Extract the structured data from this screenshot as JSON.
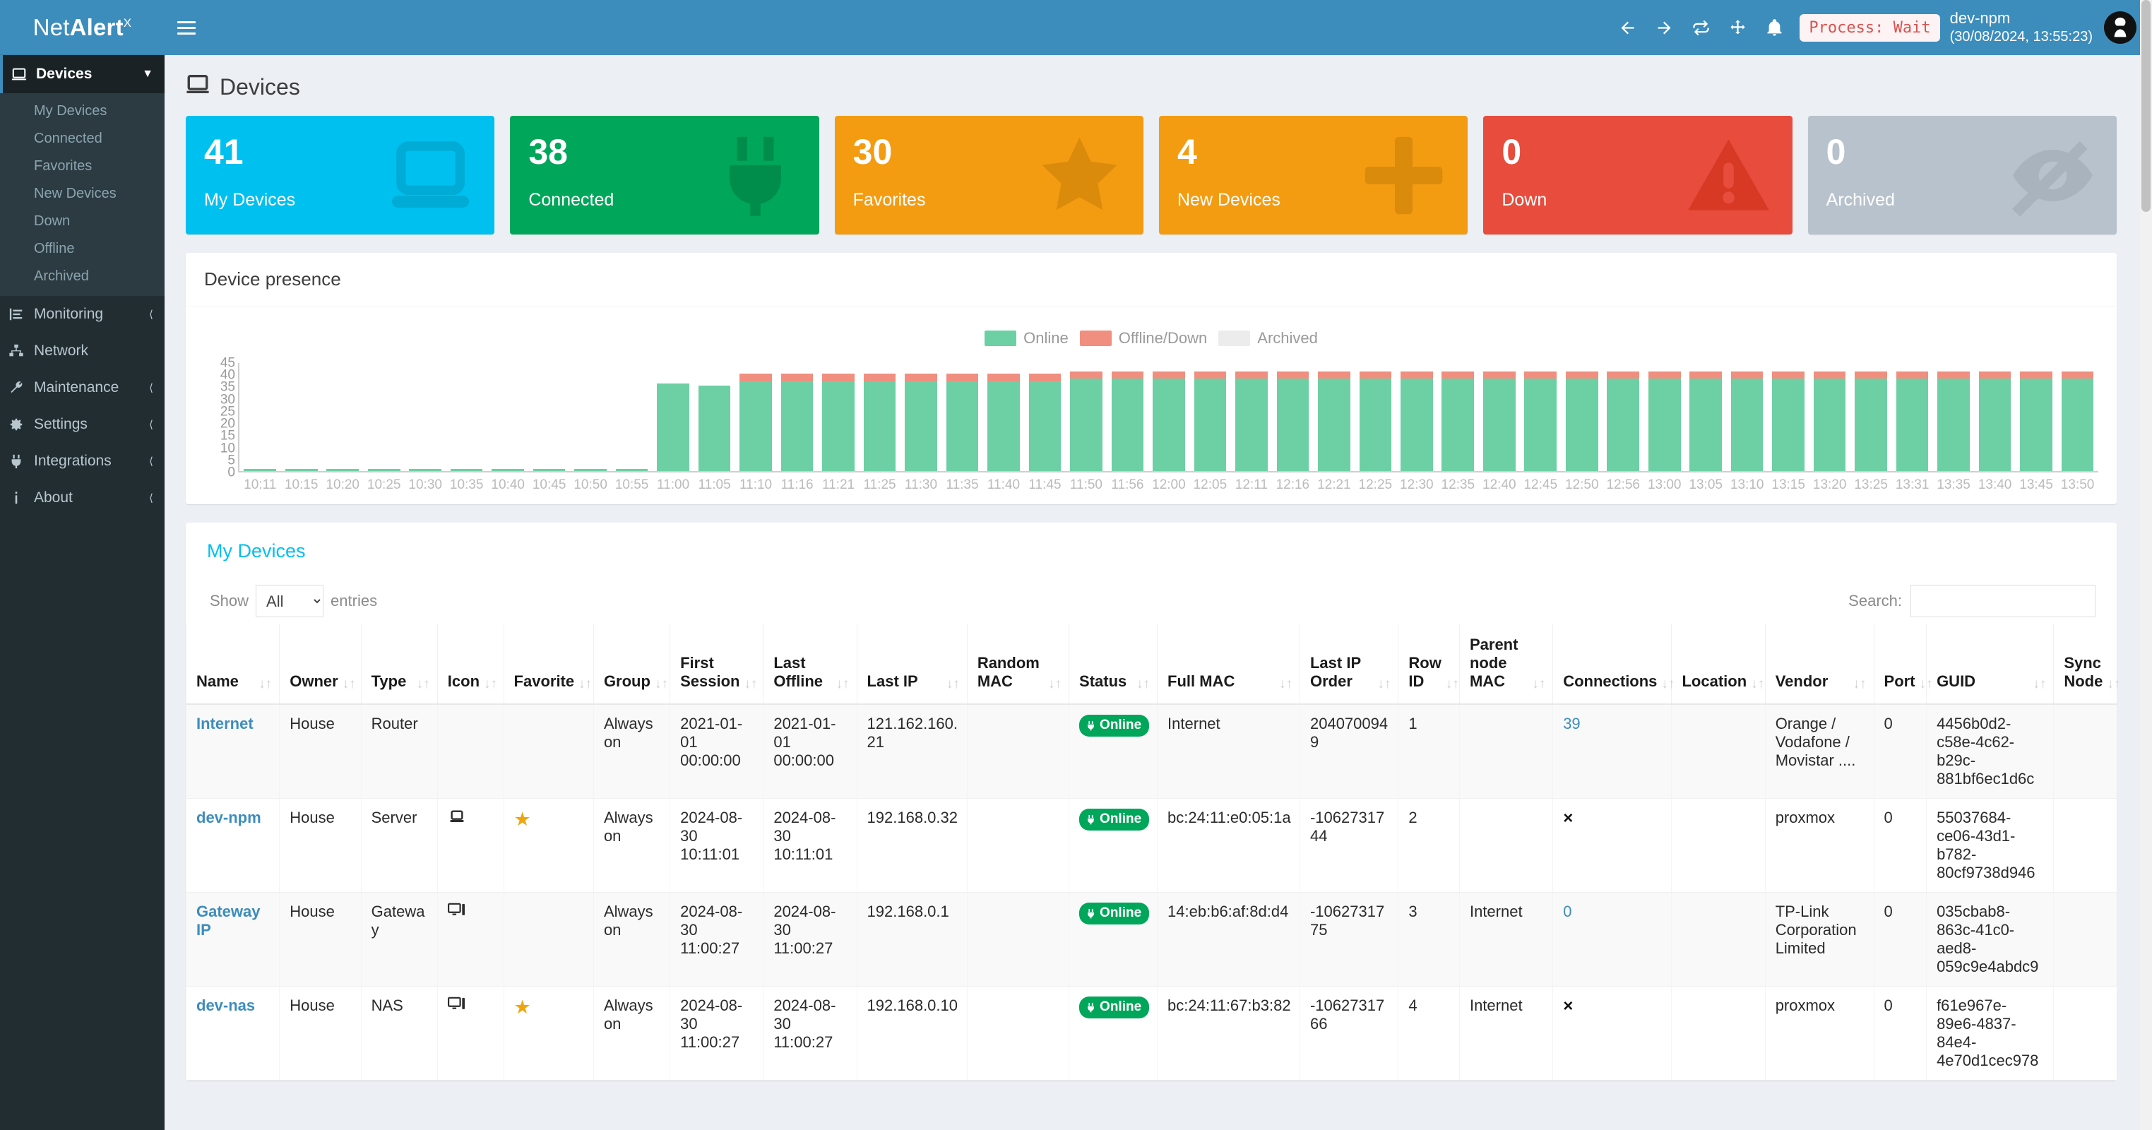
{
  "app": {
    "logo_prefix": "Net",
    "logo_bold": "Alert",
    "logo_sup": "X"
  },
  "header": {
    "icons": [
      "back-arrow-icon",
      "forward-arrow-icon",
      "refresh-icon",
      "move-icon",
      "bell-icon"
    ],
    "process_badge": "Process: Wait",
    "hostname": "dev-npm",
    "timestamp": "(30/08/2024, 13:55:23)",
    "avatar": "user-avatar"
  },
  "sidebar": {
    "active": {
      "label": "Devices",
      "icon": "laptop-icon",
      "chevron": "chevron-down-icon"
    },
    "sub_items": [
      {
        "label": "My Devices"
      },
      {
        "label": "Connected"
      },
      {
        "label": "Favorites"
      },
      {
        "label": "New Devices"
      },
      {
        "label": "Down"
      },
      {
        "label": "Offline"
      },
      {
        "label": "Archived"
      }
    ],
    "items": [
      {
        "label": "Monitoring",
        "icon": "chart-bars-icon",
        "chevron": "chevron-left-icon"
      },
      {
        "label": "Network",
        "icon": "sitemap-icon",
        "chevron": ""
      },
      {
        "label": "Maintenance",
        "icon": "wrench-icon",
        "chevron": "chevron-left-icon"
      },
      {
        "label": "Settings",
        "icon": "gear-icon",
        "chevron": "chevron-left-icon"
      },
      {
        "label": "Integrations",
        "icon": "plug-icon",
        "chevron": "chevron-left-icon"
      },
      {
        "label": "About",
        "icon": "info-icon",
        "chevron": "chevron-left-icon"
      }
    ]
  },
  "page": {
    "title": "Devices",
    "title_icon": "laptop-icon"
  },
  "cards": [
    {
      "value": "41",
      "label": "My Devices",
      "color": "#00c0ef",
      "icon_color": "#00acd6",
      "icon": "laptop-icon"
    },
    {
      "value": "38",
      "label": "Connected",
      "color": "#00a65a",
      "icon_color": "#008d4c",
      "icon": "plug-icon"
    },
    {
      "value": "30",
      "label": "Favorites",
      "color": "#f39c12",
      "icon_color": "#db8b0b",
      "icon": "star-icon"
    },
    {
      "value": "4",
      "label": "New Devices",
      "color": "#f39c12",
      "icon_color": "#db8b0b",
      "icon": "plus-icon"
    },
    {
      "value": "0",
      "label": "Down",
      "color": "#e74c3c",
      "icon_color": "#d73925",
      "icon": "warning-triangle-icon"
    },
    {
      "value": "0",
      "label": "Archived",
      "color": "#b8c2cc",
      "icon_color": "#a8b3bd",
      "icon": "eye-slash-icon"
    }
  ],
  "chart_panel": {
    "title": "Device presence"
  },
  "chart_data": {
    "type": "bar",
    "title": "Device presence",
    "xlabel": "",
    "ylabel": "",
    "ylim": [
      0,
      45
    ],
    "yticks": [
      0,
      5,
      10,
      15,
      20,
      25,
      30,
      35,
      40,
      45
    ],
    "grid": false,
    "stacked": true,
    "legend_position": "top-center",
    "legend": [
      {
        "name": "Online",
        "color": "#6cd0a4"
      },
      {
        "name": "Offline/Down",
        "color": "#f08f80"
      },
      {
        "name": "Archived",
        "color": "#ececec"
      }
    ],
    "categories": [
      "10:11",
      "10:15",
      "10:20",
      "10:25",
      "10:30",
      "10:35",
      "10:40",
      "10:45",
      "10:50",
      "10:55",
      "11:00",
      "11:05",
      "11:10",
      "11:16",
      "11:21",
      "11:25",
      "11:30",
      "11:35",
      "11:40",
      "11:45",
      "11:50",
      "11:56",
      "12:00",
      "12:05",
      "12:11",
      "12:16",
      "12:21",
      "12:25",
      "12:30",
      "12:35",
      "12:40",
      "12:45",
      "12:50",
      "12:56",
      "13:00",
      "13:05",
      "13:10",
      "13:15",
      "13:20",
      "13:25",
      "13:31",
      "13:35",
      "13:40",
      "13:45",
      "13:50"
    ],
    "series": [
      {
        "name": "Online",
        "color": "#6cd0a4",
        "values": [
          1,
          1,
          1,
          1,
          1,
          1,
          1,
          1,
          1,
          1,
          36,
          35,
          37,
          37,
          37,
          37,
          37,
          37,
          37,
          37,
          38,
          38,
          38,
          38,
          38,
          38,
          38,
          38,
          38,
          38,
          38,
          38,
          38,
          38,
          38,
          38,
          38,
          38,
          38,
          38,
          38,
          38,
          38,
          38,
          38
        ]
      },
      {
        "name": "Offline/Down",
        "color": "#f08f80",
        "values": [
          0,
          0,
          0,
          0,
          0,
          0,
          0,
          0,
          0,
          0,
          0,
          0,
          3,
          3,
          3,
          3,
          3,
          3,
          3,
          3,
          3,
          3,
          3,
          3,
          3,
          3,
          3,
          3,
          3,
          3,
          3,
          3,
          3,
          3,
          3,
          3,
          3,
          3,
          3,
          3,
          3,
          3,
          3,
          3,
          3
        ]
      },
      {
        "name": "Archived",
        "color": "#ececec",
        "values": [
          0,
          0,
          0,
          0,
          0,
          0,
          0,
          0,
          0,
          0,
          0,
          0,
          0,
          0,
          0,
          0,
          0,
          0,
          0,
          0,
          0,
          0,
          0,
          0,
          0,
          0,
          0,
          0,
          0,
          0,
          0,
          0,
          0,
          0,
          0,
          0,
          0,
          0,
          0,
          0,
          0,
          0,
          0,
          0,
          0
        ]
      }
    ]
  },
  "table": {
    "title": "My Devices",
    "show_label": "Show",
    "entries_label": "entries",
    "page_size": "All",
    "page_size_options": [
      "All",
      "10",
      "25",
      "50",
      "100"
    ],
    "search_label": "Search:",
    "search_value": "",
    "search_placeholder": "",
    "columns": [
      {
        "label": "First Session",
        "key": "first_session",
        "sortable": true
      },
      {
        "label": "Name",
        "key": "name",
        "sortable": true
      },
      {
        "label": "Owner",
        "key": "owner",
        "sortable": true
      },
      {
        "label": "Type",
        "key": "type",
        "sortable": true
      },
      {
        "label": "Icon",
        "key": "icon",
        "sortable": true
      },
      {
        "label": "Favorite",
        "key": "favorite",
        "sortable": true
      },
      {
        "label": "Group",
        "key": "group",
        "sortable": true
      },
      {
        "label": "Last Offline",
        "key": "last_offline",
        "sortable": true
      },
      {
        "label": "Last IP",
        "key": "last_ip",
        "sortable": true
      },
      {
        "label": "Random MAC",
        "key": "random_mac",
        "sortable": true
      },
      {
        "label": "Status",
        "key": "status",
        "sortable": true
      },
      {
        "label": "Full MAC",
        "key": "full_mac",
        "sortable": true
      },
      {
        "label": "Last IP Order",
        "key": "last_ip_order",
        "sortable": true
      },
      {
        "label": "Row ID",
        "key": "row_id",
        "sortable": true
      },
      {
        "label": "Parent node MAC",
        "key": "parent_node_mac",
        "sortable": true
      },
      {
        "label": "Connections",
        "key": "connections",
        "sortable": true
      },
      {
        "label": "Location",
        "key": "location",
        "sortable": true
      },
      {
        "label": "Vendor",
        "key": "vendor",
        "sortable": true
      },
      {
        "label": "Port",
        "key": "port",
        "sortable": true
      },
      {
        "label": "GUID",
        "key": "guid",
        "sortable": true
      },
      {
        "label": "Sync Node",
        "key": "sync_node",
        "sortable": true
      }
    ],
    "header_order": [
      "Name",
      "Owner",
      "Type",
      "Icon",
      "Favorite",
      "Group",
      "First Session",
      "Last Offline",
      "Last IP",
      "Random MAC",
      "Status",
      "Full MAC",
      "Last IP Order",
      "Row ID",
      "Parent node MAC",
      "Connections",
      "Location",
      "Vendor",
      "Port",
      "GUID",
      "Sync Node"
    ],
    "rows": [
      {
        "name": "Internet",
        "owner": "House",
        "type": "Router",
        "icon": "",
        "favorite": "",
        "group": "Always on",
        "first_session": "2021-01-01 00:00:00",
        "last_offline": "2021-01-01 00:00:00",
        "last_ip": "121.162.160.21",
        "random_mac": "",
        "status": "Online",
        "full_mac": "Internet",
        "last_ip_order": "2040700949",
        "row_id": "1",
        "parent_node_mac": "",
        "connections": "39",
        "connections_is_link": true,
        "location": "",
        "vendor": "Orange / Vodafone / Movistar ....",
        "port": "0",
        "guid": "4456b0d2-c58e-4c62-b29c-881bf6ec1d6c",
        "sync_node": ""
      },
      {
        "name": "dev-npm",
        "owner": "House",
        "type": "Server",
        "icon": "laptop-icon",
        "favorite": "star-icon",
        "group": "Always on",
        "first_session": "2024-08-30 10:11:01",
        "last_offline": "2024-08-30 10:11:01",
        "last_ip": "192.168.0.32",
        "random_mac": "",
        "status": "Online",
        "full_mac": "bc:24:11:e0:05:1a",
        "last_ip_order": "-1062731744",
        "row_id": "2",
        "parent_node_mac": "",
        "connections": "×",
        "connections_is_link": false,
        "location": "",
        "vendor": "proxmox",
        "port": "0",
        "guid": "55037684-ce06-43d1-b782-80cf9738d946",
        "sync_node": ""
      },
      {
        "name": "Gateway IP",
        "owner": "House",
        "type": "Gateway",
        "icon": "desktop-icon",
        "favorite": "",
        "group": "Always on",
        "first_session": "2024-08-30 11:00:27",
        "last_offline": "2024-08-30 11:00:27",
        "last_ip": "192.168.0.1",
        "random_mac": "",
        "status": "Online",
        "full_mac": "14:eb:b6:af:8d:d4",
        "last_ip_order": "-1062731775",
        "row_id": "3",
        "parent_node_mac": "Internet",
        "connections": "0",
        "connections_is_link": true,
        "location": "",
        "vendor": "TP-Link Corporation Limited",
        "port": "0",
        "guid": "035cbab8-863c-41c0-aed8-059c9e4abdc9",
        "sync_node": ""
      },
      {
        "name": "dev-nas",
        "owner": "House",
        "type": "NAS",
        "icon": "desktop-icon",
        "favorite": "star-icon",
        "group": "Always on",
        "first_session": "2024-08-30 11:00:27",
        "last_offline": "2024-08-30 11:00:27",
        "last_ip": "192.168.0.10",
        "random_mac": "",
        "status": "Online",
        "full_mac": "bc:24:11:67:b3:82",
        "last_ip_order": "-1062731766",
        "row_id": "4",
        "parent_node_mac": "Internet",
        "connections": "×",
        "connections_is_link": false,
        "location": "",
        "vendor": "proxmox",
        "port": "0",
        "guid": "f61e967e-89e6-4837-84e4-4e70d1cec978",
        "sync_node": ""
      }
    ]
  }
}
